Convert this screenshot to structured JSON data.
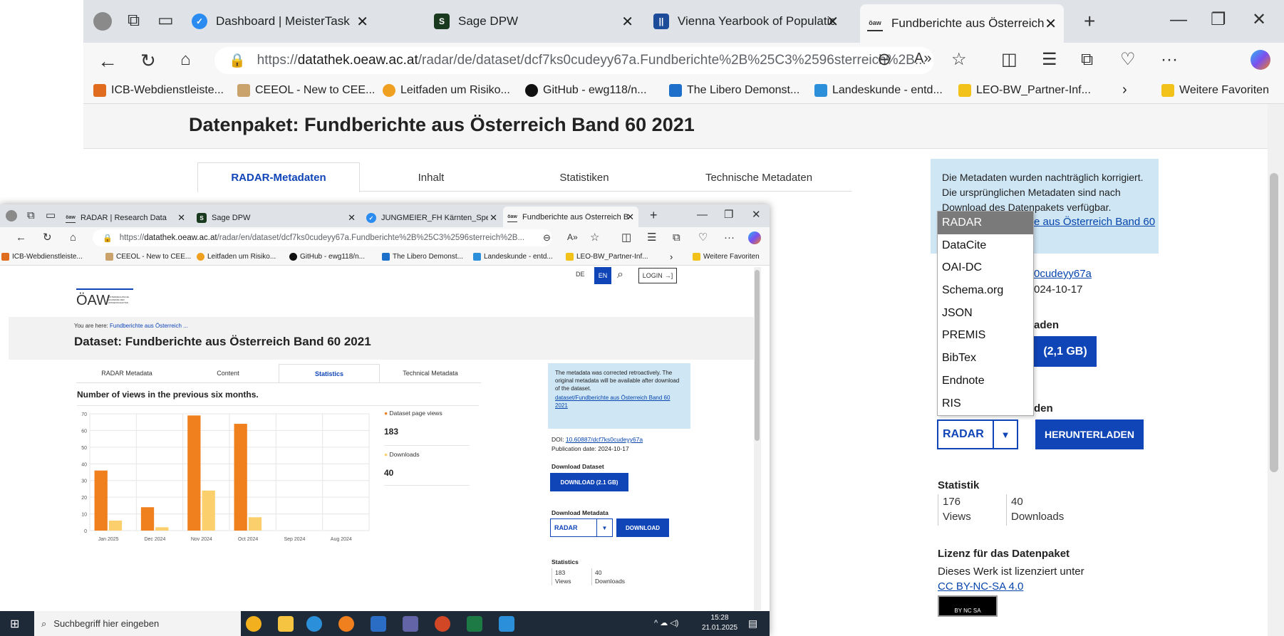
{
  "bg": {
    "tabs": [
      {
        "title": "Dashboard | MeisterTask",
        "color": "#2a8cf0"
      },
      {
        "title": "Sage DPW",
        "color": "#1a3a1f"
      },
      {
        "title": "Vienna Yearbook of Population F",
        "color": "#1c4b9a"
      },
      {
        "title": "Fundberichte aus Österreich Ban",
        "color": "#ffffff"
      }
    ],
    "url_prefix": "https://",
    "url_host": "datathek.oeaw.ac.at",
    "url_rest": "/radar/de/dataset/dcf7ks0cudeyy67a.Fundberichte%2B%25C3%2596sterreich%2B...",
    "bookmarks": [
      {
        "label": "ICB-Webdienstleiste...",
        "color": "#e06c1f"
      },
      {
        "label": "CEEOL - New to CEE...",
        "color": "#c9a36b"
      },
      {
        "label": "Leitfaden um Risiko...",
        "color": "#f0a020"
      },
      {
        "label": "GitHub - ewg118/n...",
        "color": "#111111"
      },
      {
        "label": "The Libero Demonst...",
        "color": "#1d6fc9"
      },
      {
        "label": "Landeskunde - entd...",
        "color": "#2b8fd9"
      },
      {
        "label": "LEO-BW_Partner-Inf...",
        "color": "#f2c21b"
      }
    ],
    "more_favorites": "Weitere Favoriten",
    "page_title": "Datenpaket: Fundberichte aus Österreich Band 60 2021",
    "tabs_nav": [
      "RADAR-Metadaten",
      "Inhalt",
      "Statistiken",
      "Technische Metadaten"
    ],
    "info_text": "Die Metadaten wurden nachträglich korrigiert. Die ursprünglichen Metadaten sind nach Download des Datenpakets verfügbar.",
    "info_link": "e aus Österreich Band 60",
    "doi_partial": "0cudeyy67a",
    "date_partial": "024-10-17",
    "download_partial": "aden",
    "download_btn_partial": "(2,1 GB)",
    "meta_download_partial": "den",
    "dropdown_options": [
      "RADAR",
      "DataCite",
      "OAI-DC",
      "Schema.org",
      "JSON",
      "PREMIS",
      "BibTex",
      "Endnote",
      "RIS"
    ],
    "select_value": "RADAR",
    "download_btn": "HERUNTERLADEN",
    "statistik_label": "Statistik",
    "stat_views": "176",
    "stat_views_label": "Views",
    "stat_downloads": "40",
    "stat_downloads_label": "Downloads",
    "license_heading": "Lizenz für das Datenpaket",
    "license_text": "Dieses Werk ist lizenziert unter",
    "license_link": "CC BY-NC-SA 4.0",
    "cc_badge": "BY NC SA"
  },
  "fg": {
    "tabs": [
      {
        "title": "RADAR | Research Data",
        "color": "#ffffff"
      },
      {
        "title": "Sage DPW",
        "color": "#1a3a1f"
      },
      {
        "title": "JUNGMEIER_FH Kärnten_Speik_E",
        "color": "#2a8cf0"
      },
      {
        "title": "Fundberichte aus Österreich Ban",
        "color": "#ffffff"
      }
    ],
    "url_prefix": "https://",
    "url_host": "datathek.oeaw.ac.at",
    "url_rest": "/radar/en/dataset/dcf7ks0cudeyy67a.Fundberichte%2B%25C3%2596sterreich%2B...",
    "bookmarks": [
      {
        "label": "ICB-Webdienstleiste...",
        "color": "#e06c1f"
      },
      {
        "label": "CEEOL - New to CEE...",
        "color": "#c9a36b"
      },
      {
        "label": "Leitfaden um Risiko...",
        "color": "#f0a020"
      },
      {
        "label": "GitHub - ewg118/n...",
        "color": "#111111"
      },
      {
        "label": "The Libero Demonst...",
        "color": "#1d6fc9"
      },
      {
        "label": "Landeskunde - entd...",
        "color": "#2b8fd9"
      },
      {
        "label": "LEO-BW_Partner-Inf...",
        "color": "#f2c21b"
      }
    ],
    "more_favorites": "Weitere Favoriten",
    "lang_de": "DE",
    "lang_en": "EN",
    "login": "LOGIN",
    "logo": "ÖAW",
    "logo_sub": "ÖSTERREICHISCHE AKADEMIE DER WISSENSCHAFTEN",
    "breadcrumb_prefix": "You are here:",
    "breadcrumb_link": "Fundberichte aus Österreich ...",
    "page_title": "Dataset: Fundberichte aus Österreich Band 60 2021",
    "tabs_nav": [
      "RADAR Metadata",
      "Content",
      "Statistics",
      "Technical Metadata"
    ],
    "stats_heading": "Number of views in the previous six months.",
    "legend_views": "Dataset page views",
    "views_value": "183",
    "legend_downloads": "Downloads",
    "downloads_value": "40",
    "info_text": "The metadata was corrected retroactively. The original metadata will be available after download of the dataset.",
    "info_link": "dataset/Fundberichte aus Österreich Band 60 2021",
    "doi_label": "DOI:",
    "doi_link": "10.60887/dcf7ks0cudeyy67a",
    "pub_date": "Publication date: 2024-10-17",
    "download_dataset_label": "Download Dataset",
    "download_dataset_btn": "DOWNLOAD (2.1 GB)",
    "download_meta_label": "Download Metadata",
    "select_value": "RADAR",
    "download_btn": "DOWNLOAD",
    "statistics_label": "Statistics",
    "stat_views": "183",
    "stat_views_label": "Views",
    "stat_downloads": "40",
    "stat_downloads_label": "Downloads",
    "search_placeholder": "Suchbegriff hier eingeben",
    "time": "15:28",
    "date": "21.01.2025",
    "chart_data": {
      "type": "bar",
      "categories": [
        "Jan 2025",
        "Dec 2024",
        "Nov 2024",
        "Oct 2024",
        "Sep 2024",
        "Aug 2024"
      ],
      "series": [
        {
          "name": "Dataset page views",
          "values": [
            36,
            14,
            69,
            64,
            0,
            0
          ],
          "color": "#f07f1d"
        },
        {
          "name": "Downloads",
          "values": [
            6,
            2,
            24,
            8,
            0,
            0
          ],
          "color": "#fbcf6b"
        }
      ],
      "yticks": [
        0,
        10,
        20,
        30,
        40,
        50,
        60,
        70
      ],
      "ylim": [
        0,
        70
      ],
      "grid": true
    }
  }
}
